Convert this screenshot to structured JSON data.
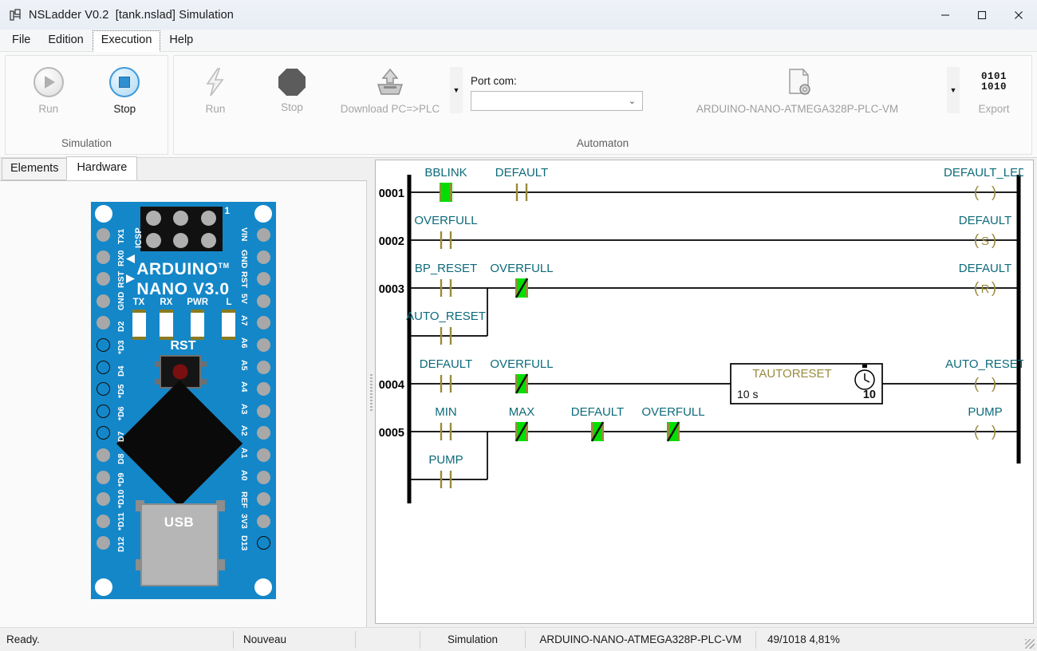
{
  "window": {
    "app_name": "NSLadder V0.2",
    "file": "[tank.nslad]",
    "mode": "Simulation",
    "title": "NSLadder V0.2  [tank.nslad] Simulation",
    "minimize": "—",
    "maximize": "☐",
    "close": "✕"
  },
  "menu": {
    "items": [
      {
        "label": "File",
        "active": false
      },
      {
        "label": "Edition",
        "active": false
      },
      {
        "label": "Execution",
        "active": true
      },
      {
        "label": "Help",
        "active": false
      }
    ]
  },
  "ribbon": {
    "simulation_group": {
      "caption": "Simulation",
      "run_label": "Run",
      "stop_label": "Stop"
    },
    "automaton_group": {
      "caption": "Automaton",
      "run_label": "Run",
      "stop_label": "Stop",
      "download_label": "Download PC=>PLC",
      "port_label": "Port com:",
      "port_value": "",
      "port_placeholder": "",
      "device_label": "ARDUINO-NANO-ATMEGA328P-PLC-VM",
      "export_label": "Export",
      "export_icon_top": "0101",
      "export_icon_bottom": "1010",
      "dropdown_glyph": "▼",
      "combo_glyph": "⌄"
    }
  },
  "left_panel": {
    "tabs": [
      {
        "label": "Elements",
        "active": false
      },
      {
        "label": "Hardware",
        "active": true
      }
    ],
    "board": {
      "brand_line1": "ARDUINO",
      "brand_tm": "TM",
      "brand_line2": "NANO V3.0",
      "icsp_label": "ICSP",
      "pin1_label": "1",
      "reset_label": "RST",
      "usb_label": "USB",
      "leds": [
        "TX",
        "RX",
        "PWR",
        "L"
      ],
      "left_pins": [
        "TX1",
        "RX0",
        "RST",
        "GND",
        "D2",
        "*D3",
        "D4",
        "*D5",
        "*D6",
        "D7",
        "D8",
        "*D9",
        "*D10",
        "*D11",
        "D12"
      ],
      "right_pins": [
        "VIN",
        "GND",
        "RST",
        "5V",
        "A7",
        "A6",
        "A5",
        "A4",
        "A3",
        "A2",
        "A1",
        "A0",
        "REF",
        "3V3",
        "D13"
      ]
    }
  },
  "ladder": {
    "rung_numbers": [
      "0001",
      "0002",
      "0003",
      "0004",
      "0005"
    ],
    "rungs": [
      {
        "number": "0001",
        "branches": [
          {
            "contacts": [
              {
                "label": "BBLINK",
                "type": "NO",
                "active": true
              },
              {
                "label": "DEFAULT",
                "type": "NO",
                "active": false
              }
            ]
          }
        ],
        "coil": {
          "label": "DEFAULT_LED",
          "type": "()"
        }
      },
      {
        "number": "0002",
        "branches": [
          {
            "contacts": [
              {
                "label": "OVERFULL",
                "type": "NO",
                "active": false
              }
            ]
          }
        ],
        "coil": {
          "label": "DEFAULT",
          "type": "(S)"
        }
      },
      {
        "number": "0003",
        "branches": [
          {
            "contacts": [
              {
                "label": "BP_RESET",
                "type": "NO",
                "active": false
              }
            ]
          },
          {
            "contacts": [
              {
                "label": "AUTO_RESET",
                "type": "NO",
                "active": false
              }
            ]
          },
          {
            "contacts": [
              {
                "label": "OVERFULL",
                "type": "NC",
                "active": true
              }
            ]
          }
        ],
        "coil": {
          "label": "DEFAULT",
          "type": "(R)"
        }
      },
      {
        "number": "0004",
        "branches": [
          {
            "contacts": [
              {
                "label": "DEFAULT",
                "type": "NO",
                "active": false
              },
              {
                "label": "OVERFULL",
                "type": "NC",
                "active": true
              }
            ]
          }
        ],
        "block": {
          "name": "TAUTORESET",
          "preset": "10 s",
          "value": "10",
          "icon": "timer-icon"
        },
        "coil": {
          "label": "AUTO_RESET",
          "type": "()"
        }
      },
      {
        "number": "0005",
        "branches": [
          {
            "contacts": [
              {
                "label": "MIN",
                "type": "NO",
                "active": false
              },
              {
                "label": "MAX",
                "type": "NC",
                "active": true
              },
              {
                "label": "DEFAULT",
                "type": "NC",
                "active": true
              },
              {
                "label": "OVERFULL",
                "type": "NC",
                "active": true
              }
            ]
          },
          {
            "contacts": [
              {
                "label": "PUMP",
                "type": "NO",
                "active": false
              }
            ]
          }
        ],
        "coil": {
          "label": "PUMP",
          "type": "()"
        }
      }
    ],
    "colors": {
      "label": "#0d6b7a",
      "symbol": "#9a8a3c",
      "active_highlight": "#00e000",
      "rail": "#000000"
    }
  },
  "statusbar": {
    "ready": "Ready.",
    "document": "Nouveau",
    "blank": "",
    "mode": "Simulation",
    "device": "ARDUINO-NANO-ATMEGA328P-PLC-VM",
    "memory": "49/1018  4,81%"
  }
}
